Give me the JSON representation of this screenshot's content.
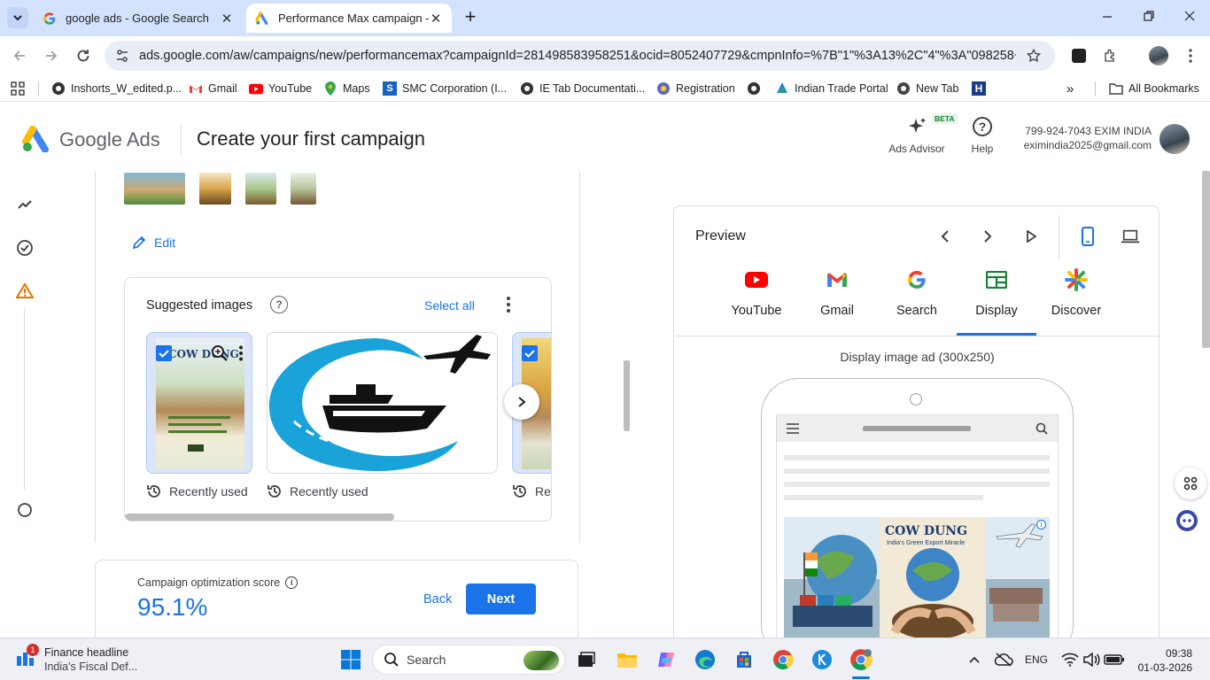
{
  "browser": {
    "tabs": [
      {
        "title": "google ads - Google Search",
        "active": false
      },
      {
        "title": "Performance Max campaign - E",
        "active": true
      }
    ],
    "url": "ads.google.com/aw/campaigns/new/performancemax?campaignId=281498583958251&ocid=8052407729&cmpnInfo=%7B\"1\"%3A13%2C\"4\"%3A\"098258+66...",
    "bookmarks": [
      {
        "label": "Inshorts_W_edited.p...",
        "icon": "globe-icon"
      },
      {
        "label": "Gmail",
        "icon": "gmail-icon"
      },
      {
        "label": "YouTube",
        "icon": "youtube-icon"
      },
      {
        "label": "Maps",
        "icon": "maps-icon"
      },
      {
        "label": "SMC Corporation (I...",
        "icon": "smc-icon"
      },
      {
        "label": "IE Tab Documentati...",
        "icon": "globe-icon"
      },
      {
        "label": "Registration",
        "icon": "registration-icon"
      },
      {
        "label": "Indian Trade Portal",
        "icon": "trade-icon"
      },
      {
        "label": "New Tab",
        "icon": "chrome-icon"
      }
    ],
    "all_bookmarks": "All Bookmarks"
  },
  "ads_header": {
    "logo": "Google Ads",
    "page_title": "Create your first campaign",
    "advisor_label": "Ads Advisor",
    "advisor_badge": "BETA",
    "help_label": "Help",
    "account_name": "799-924-7043 EXIM INDIA",
    "account_email": "eximindia2025@gmail.com"
  },
  "main": {
    "edit_label": "Edit",
    "suggested": {
      "title": "Suggested images",
      "select_all": "Select all",
      "tiles": [
        {
          "caption": "Recently used",
          "checked": true,
          "poster_title": "COW DUNG"
        },
        {
          "caption": "Recently used",
          "checked": false
        },
        {
          "caption": "Rec",
          "checked": true
        }
      ]
    }
  },
  "score": {
    "label": "Campaign optimization score",
    "value": "95.1%",
    "back": "Back",
    "next": "Next"
  },
  "preview": {
    "title": "Preview",
    "channels": [
      {
        "label": "YouTube",
        "icon": "youtube-icon"
      },
      {
        "label": "Gmail",
        "icon": "gmail-icon"
      },
      {
        "label": "Search",
        "icon": "google-g-icon"
      },
      {
        "label": "Display",
        "icon": "display-icon",
        "selected": true
      },
      {
        "label": "Discover",
        "icon": "discover-icon"
      }
    ],
    "caption": "Display image ad (300x250)",
    "ad_title": "COW DUNG",
    "ad_subtitle": "India's Green Export Miracle"
  },
  "taskbar": {
    "news_badge": "1",
    "news_title": "Finance headline",
    "news_sub": "India's Fiscal Def...",
    "search_label": "Search",
    "lang": "ENG",
    "time": "09:38",
    "date": "01-03-2026"
  },
  "colors": {
    "accent": "#1a73e8",
    "tabstrip": "#d3e3fd",
    "warning": "#e37400"
  }
}
